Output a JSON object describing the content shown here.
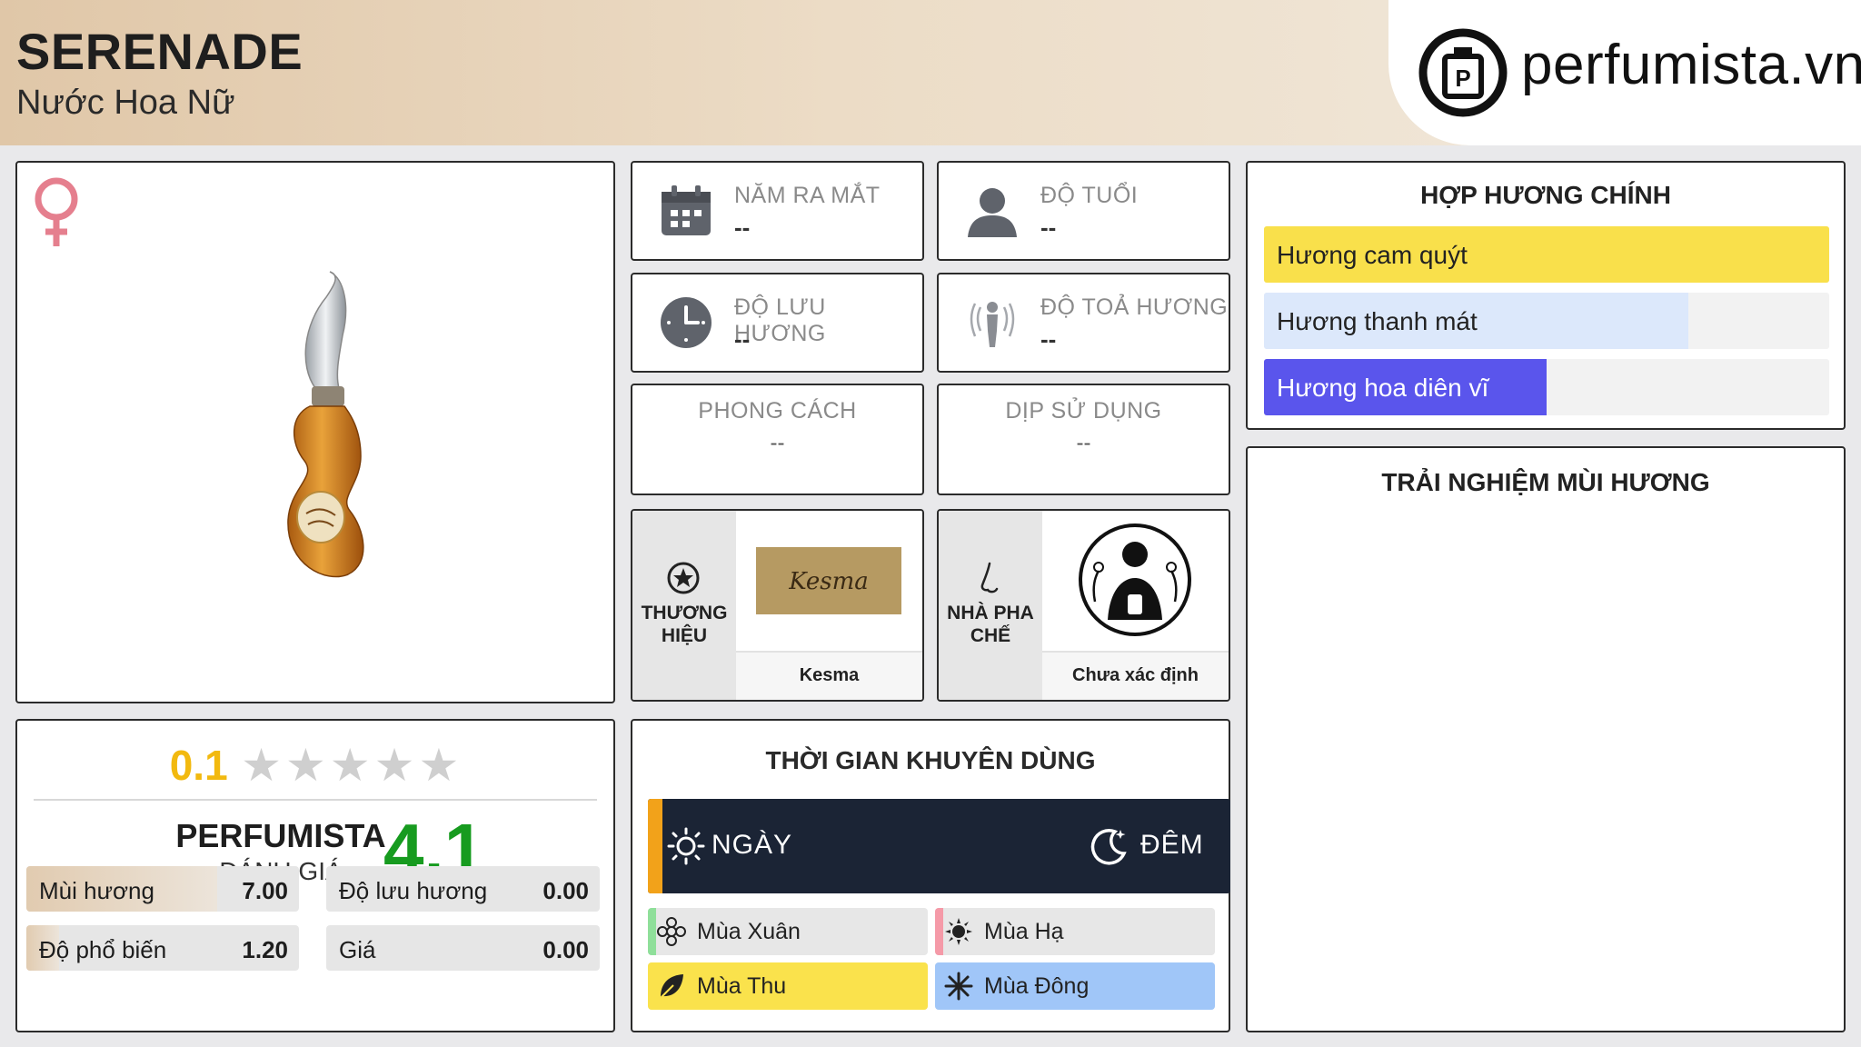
{
  "header": {
    "title": "SERENADE",
    "subtitle": "Nước Hoa Nữ",
    "logo_text": "perfumista.vn",
    "logo_icon": "perfume-bottle-icon"
  },
  "product": {
    "gender_icon": "female-symbol-icon",
    "image": "perfume-bottle-image"
  },
  "rating": {
    "score": "0.1",
    "stars_max": 5,
    "brand": "PERFUMISTA",
    "brand_sub": "ĐÁNH GIÁ",
    "perfumista_score": "4.1",
    "metrics": [
      {
        "label": "Mùi hương",
        "value": "7.00",
        "fraction": 0.7
      },
      {
        "label": "Độ lưu hương",
        "value": "0.00",
        "fraction": 0.0
      },
      {
        "label": "Độ phổ biến",
        "value": "1.20",
        "fraction": 0.12
      },
      {
        "label": "Giá",
        "value": "0.00",
        "fraction": 0.0
      }
    ]
  },
  "info": {
    "launch_year": {
      "label": "NĂM RA MẮT",
      "value": "--",
      "icon": "calendar-icon"
    },
    "age": {
      "label": "ĐỘ TUỔI",
      "value": "--",
      "icon": "user-icon"
    },
    "longevity": {
      "label": "ĐỘ LƯU HƯƠNG",
      "value": "--",
      "icon": "clock-icon"
    },
    "sillage": {
      "label": "ĐỘ TOẢ HƯƠNG",
      "value": "--",
      "icon": "sillage-person-icon"
    },
    "style": {
      "label": "PHONG CÁCH",
      "value": "--"
    },
    "occasion": {
      "label": "DỊP SỬ DỤNG",
      "value": "--"
    }
  },
  "brand_card": {
    "label": "THƯƠNG HIỆU",
    "name": "Kesma",
    "logo_text": "Kesma",
    "icon": "star-badge-icon"
  },
  "perfumer_card": {
    "label": "NHÀ PHA CHẾ",
    "name": "Chưa xác định",
    "icon": "nose-icon",
    "image": "perfumer-illustration"
  },
  "time": {
    "title": "THỜI GIAN KHUYÊN DÙNG",
    "day": "NGÀY",
    "night": "ĐÊM",
    "seasons": [
      {
        "label": "Mùa Xuân",
        "color": "#8fdf9a",
        "fraction": 0.03,
        "icon": "flower-icon"
      },
      {
        "label": "Mùa Hạ",
        "color": "#f59aa8",
        "fraction": 0.03,
        "icon": "sun-icon"
      },
      {
        "label": "Mùa Thu",
        "color": "#fae24c",
        "fraction": 1.0,
        "icon": "leaf-icon"
      },
      {
        "label": "Mùa Đông",
        "color": "#a0c6f8",
        "fraction": 1.0,
        "icon": "snowflake-icon"
      }
    ]
  },
  "accords": {
    "title": "HỢP HƯƠNG CHÍNH",
    "items": [
      {
        "label": "Hương cam quýt",
        "color": "#f9e04b",
        "text_color": "#222222",
        "fraction": 1.0
      },
      {
        "label": "Hương thanh mát",
        "color": "#dce8fb",
        "text_color": "#222222",
        "fraction": 0.75
      },
      {
        "label": "Hương hoa diên vĩ",
        "color": "#5a55ec",
        "text_color": "#ffffff",
        "fraction": 0.5
      }
    ]
  },
  "experience": {
    "title": "TRẢI NGHIỆM MÙI HƯƠNG"
  }
}
